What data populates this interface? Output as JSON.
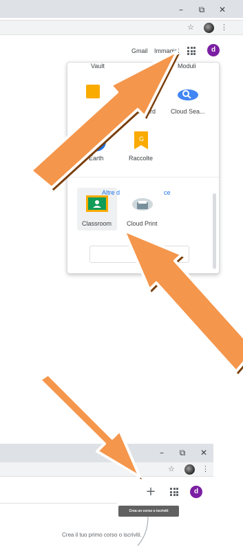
{
  "top_window": {
    "controls": {
      "minimize": "–",
      "restore": "⧉",
      "close": "✕"
    },
    "toolbar": {
      "star": "☆",
      "menu": "⋮"
    },
    "header_links": {
      "gmail": "Gmail",
      "images": "Immagini"
    },
    "avatar_letter": "d"
  },
  "apps_panel": {
    "top_row": [
      "Vault",
      "Moduli"
    ],
    "apps": [
      {
        "label": "Jamboard",
        "icon": "jamboard-icon"
      },
      {
        "label": "Cloud Sea...",
        "icon": "cloud-search-icon"
      },
      {
        "label": "Earth",
        "icon": "earth-icon"
      },
      {
        "label": "Raccolte",
        "icon": "collections-icon"
      },
      {
        "label": "Classroom",
        "icon": "classroom-icon"
      },
      {
        "label": "Cloud Print",
        "icon": "cloud-print-icon"
      }
    ],
    "more_button_parts": [
      "Altre d",
      "ce"
    ]
  },
  "bottom_window": {
    "controls": {
      "minimize": "–",
      "restore": "⧉",
      "close": "✕"
    },
    "toolbar": {
      "star": "☆",
      "menu": "⋮"
    },
    "add_button": "+",
    "tooltip": "Crea un corso o iscriviti",
    "avatar_letter": "d",
    "empty_state": "Crea il tuo primo corso o iscriviti."
  },
  "colors": {
    "avatar": "#7b1fa2",
    "arrow_fill": "#f4964c",
    "arrow_shadow": "#8a4a12",
    "link_blue": "#1a73e8"
  }
}
